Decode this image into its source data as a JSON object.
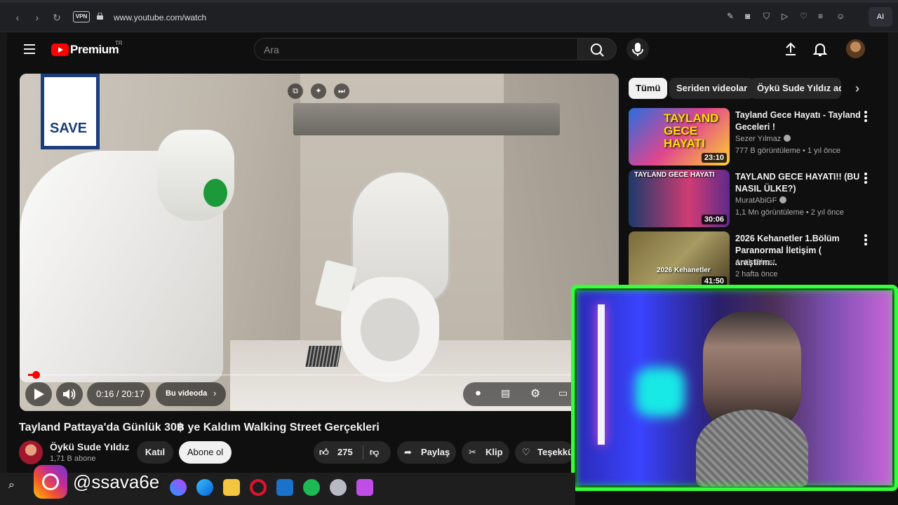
{
  "browser": {
    "vpn_label": "VPN",
    "url": "www.youtube.com/watch",
    "ai_label": "AI"
  },
  "header": {
    "logo_text": "Premium",
    "country": "TR",
    "search_placeholder": "Ara"
  },
  "player": {
    "current_time": "0:16",
    "duration": "20:17",
    "time_display": "0:16 / 20:17",
    "progress_fraction": 0.013,
    "chapter_label": "Bu videoda",
    "sign_text": "SAVE"
  },
  "video": {
    "title": "Tayland Pattaya'da Günlük 30฿ ye Kaldım Walking Street Gerçekleri",
    "channel_name": "Öykü Sude Yıldız",
    "subscribers": "1,71 B abone",
    "join_label": "Katıl",
    "subscribe_label": "Abone ol",
    "likes": "275",
    "share_label": "Paylaş",
    "clip_label": "Klip",
    "thanks_label": "Teşekkü"
  },
  "chips": [
    "Tümü",
    "Seriden videolar",
    "Öykü Sude Yıldız adl"
  ],
  "recommendations": [
    {
      "title": "Tayland Gece Hayatı - Tayland Geceleri !",
      "channel": "Sezer Yılmaz",
      "verified": true,
      "meta": "777 B görüntüleme • 1 yıl önce",
      "duration": "23:10",
      "thumb_text": "TAYLAND GECE HAYATI"
    },
    {
      "title": "TAYLAND GECE HAYATI!! (BU NASIL ÜLKE?)",
      "channel": "MuratAbiGF",
      "verified": true,
      "meta": "1,1 Mn görüntüleme • 2 yıl önce",
      "duration": "30:06",
      "thumb_text": "TAYLAND GECE HAYATI"
    },
    {
      "title": "2026 Kehanetler 1.Bölüm Paranormal İletişim ( araştırm...",
      "channel": "Antik Ghost",
      "verified": false,
      "meta": "2 hafta önce",
      "duration": "41:50",
      "thumb_text": "2026 Kehanetler"
    }
  ],
  "overlay": {
    "instagram_handle": "@ssava6e"
  },
  "colors": {
    "brand_red": "#ff0000",
    "webcam_frame": "#34ff3a",
    "background": "#0f0f0f"
  }
}
